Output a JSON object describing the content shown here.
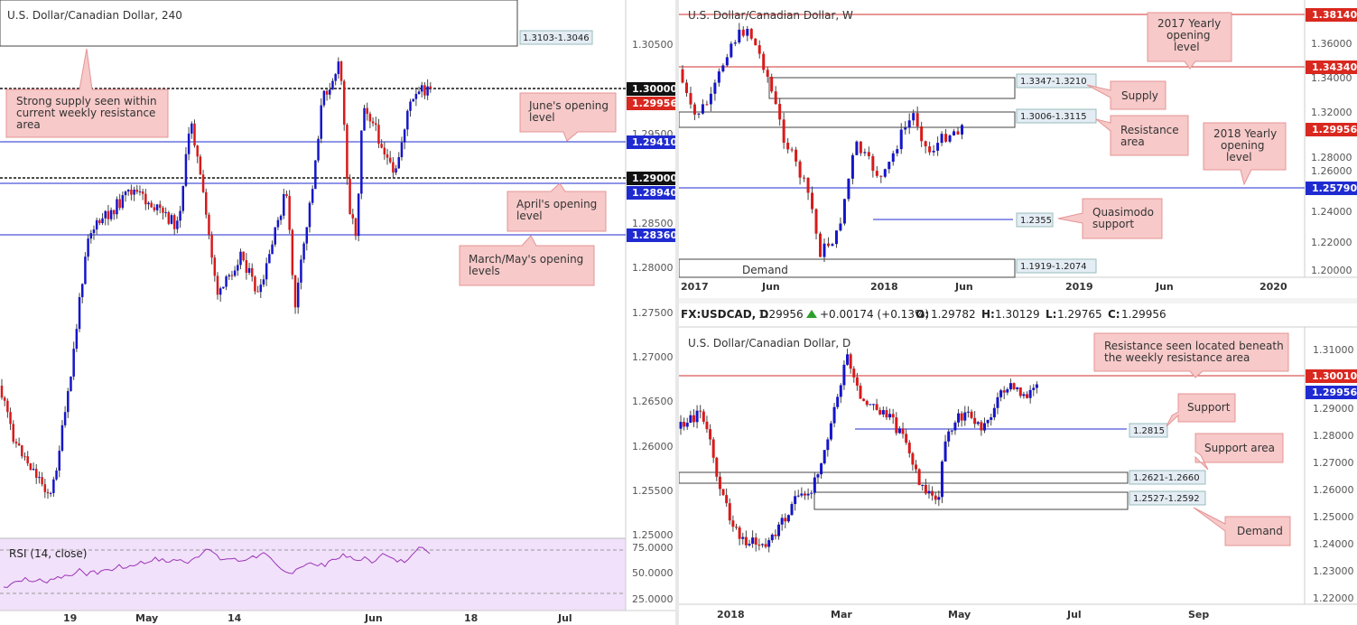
{
  "colors": {
    "up": "#1515c8",
    "down": "#d81a1a",
    "level_blue": "#1f2bd1",
    "level_red": "#d32f2f",
    "callout_bg": "#f7c9c9",
    "callout_border": "#e59494",
    "rsi_fill": "#f1e1fa",
    "rsi_line": "#9a34b6",
    "price_tag_black": "#111111",
    "price_tag_red": "#d9281f",
    "price_tag_blue": "#1f2bd1"
  },
  "panels": {
    "h4": {
      "title": "U.S. Dollar/Canadian Dollar, 240",
      "y_ticks": [
        "1.30500",
        "1.29500",
        "1.28500",
        "1.28000",
        "1.27500",
        "1.27000",
        "1.26500",
        "1.26000",
        "1.25500",
        "1.25000"
      ],
      "x_ticks": [
        "19",
        "May",
        "14",
        "Jun",
        "18",
        "Jul"
      ],
      "zone": {
        "label": "1.3103-1.3046"
      },
      "price_tags": [
        {
          "text": "1.30000",
          "style": "black"
        },
        {
          "text": "1.29956",
          "style": "red"
        },
        {
          "text": "1.29410",
          "style": "blue"
        },
        {
          "text": "1.29000",
          "style": "black"
        },
        {
          "text": "1.28940",
          "style": "blue"
        },
        {
          "text": "1.28360",
          "style": "blue"
        }
      ],
      "callouts": [
        {
          "lines": [
            "Strong supply seen within",
            "current weekly resistance",
            "area"
          ]
        },
        {
          "lines": [
            "June's opening",
            "level"
          ]
        },
        {
          "lines": [
            "April's opening",
            "level"
          ]
        },
        {
          "lines": [
            "March/May's opening",
            "levels"
          ]
        }
      ],
      "rsi": {
        "label": "RSI (14, close)",
        "ticks": [
          "75.0000",
          "50.0000",
          "25.0000"
        ]
      }
    },
    "weekly": {
      "title": "U.S. Dollar/Canadian Dollar, W",
      "y_ticks": [
        "1.36000",
        "1.34000",
        "1.32000",
        "1.28000",
        "1.26000",
        "1.24000",
        "1.22000",
        "1.20000"
      ],
      "x_ticks": [
        "2017",
        "Jun",
        "2018",
        "Jun",
        "2019",
        "Jun",
        "2020"
      ],
      "zones": [
        {
          "label": "1.3347-1.3210"
        },
        {
          "label": "1.3006-1.3115"
        },
        {
          "label": "1.1919-1.2074"
        }
      ],
      "demand_label": "Demand",
      "level_label": "1.2355",
      "price_tags": [
        {
          "text": "1.38140",
          "style": "red"
        },
        {
          "text": "1.34340",
          "style": "red"
        },
        {
          "text": "1.29956",
          "style": "red"
        },
        {
          "text": "1.25790",
          "style": "blue"
        }
      ],
      "callouts": [
        {
          "lines": [
            "2017 Yearly",
            "opening",
            "level"
          ]
        },
        {
          "lines": [
            "Supply"
          ]
        },
        {
          "lines": [
            "Resistance",
            "area"
          ]
        },
        {
          "lines": [
            "2018 Yearly",
            "opening",
            "level"
          ]
        },
        {
          "lines": [
            "Quasimodo",
            "support"
          ]
        }
      ]
    },
    "daily": {
      "legend": {
        "symbol": "FX:USDCAD, D",
        "last": "1.29956",
        "change": "+0.00174 (+0.13%)",
        "o_label": "O:",
        "o": "1.29782",
        "h_label": "H:",
        "h": "1.30129",
        "l_label": "L:",
        "l": "1.29765",
        "c_label": "C:",
        "c": "1.29956"
      },
      "title": "U.S. Dollar/Canadian Dollar, D",
      "y_ticks": [
        "1.31000",
        "1.29000",
        "1.28000",
        "1.27000",
        "1.26000",
        "1.25000",
        "1.24000",
        "1.23000",
        "1.22000"
      ],
      "x_ticks": [
        "2018",
        "Mar",
        "May",
        "Jul",
        "Sep"
      ],
      "zones": [
        {
          "label": "1.2621-1.2660"
        },
        {
          "label": "1.2527-1.2592"
        }
      ],
      "level_label": "1.2815",
      "price_tags": [
        {
          "text": "1.30010",
          "style": "red"
        },
        {
          "text": "1.29956",
          "style": "blue"
        }
      ],
      "callouts": [
        {
          "lines": [
            "Resistance seen located beneath",
            "the weekly resistance area"
          ]
        },
        {
          "lines": [
            "Support"
          ]
        },
        {
          "lines": [
            "Support area"
          ]
        },
        {
          "lines": [
            "Demand"
          ]
        }
      ]
    }
  }
}
